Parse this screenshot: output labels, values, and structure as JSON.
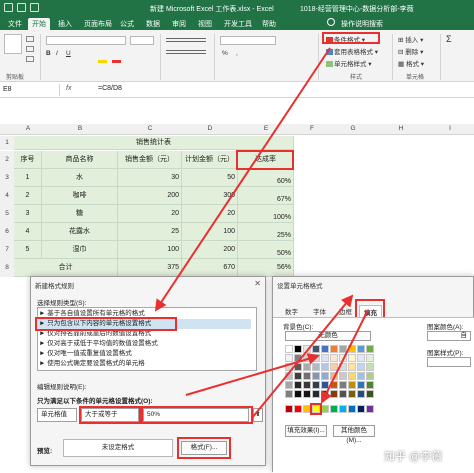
{
  "titlebar": {
    "title": "新建 Microsoft Excel 工作表.xlsx - Excel",
    "right_title": "1018-经营管理中心-数据分析部-李薇"
  },
  "tabs": [
    "文件",
    "开始",
    "插入",
    "页面布局",
    "公式",
    "数据",
    "审阅",
    "视图",
    "开发工具",
    "帮助",
    "操作说明搜索"
  ],
  "ribbon": {
    "groups": [
      "剪贴板",
      "样式",
      "单元格"
    ],
    "cond_format": "条件格式",
    "format_as_table": "套用表格格式",
    "cell_style": "单元格样式",
    "insert": "插入",
    "delete": "删除",
    "format": "格式"
  },
  "formula_bar": {
    "name_box": "E8",
    "fx": "fx",
    "formula": "=C8/D8"
  },
  "sheet": {
    "columns": [
      "A",
      "B",
      "C",
      "D",
      "E",
      "F",
      "G",
      "H",
      "I"
    ],
    "title": "销售统计表",
    "headers": [
      "序号",
      "商品名称",
      "销售金额（元）",
      "计划金额（元）",
      "达成率"
    ],
    "rows": [
      {
        "no": "1",
        "name": "水",
        "sales": "30",
        "plan": "50",
        "rate": "60%"
      },
      {
        "no": "2",
        "name": "咖啡",
        "sales": "200",
        "plan": "300",
        "rate": "67%"
      },
      {
        "no": "3",
        "name": "糖",
        "sales": "20",
        "plan": "20",
        "rate": "100%"
      },
      {
        "no": "4",
        "name": "花露水",
        "sales": "25",
        "plan": "100",
        "rate": "25%"
      },
      {
        "no": "5",
        "name": "湿巾",
        "sales": "100",
        "plan": "200",
        "rate": "50%"
      }
    ],
    "total": {
      "label": "合计",
      "sales": "375",
      "plan": "670",
      "rate": "56%"
    },
    "row_numbers": [
      "1",
      "2",
      "3",
      "4",
      "5",
      "6",
      "7",
      "8",
      "9",
      "10"
    ]
  },
  "rule_dialog": {
    "title": "新建格式规则",
    "select_type_label": "选择规则类型(S):",
    "rule_types": [
      "► 基于各自值设置所有单元格的格式",
      "► 只为包含以下内容的单元格设置格式",
      "► 仅对排名靠前或靠后的数值设置格式",
      "► 仅对高于或低于平均值的数值设置格式",
      "► 仅对唯一值或重复值设置格式",
      "► 使用公式确定要设置格式的单元格"
    ],
    "edit_label": "编辑规则说明(E):",
    "format_only_label": "只为满足以下条件的单元格设置格式(O):",
    "cond_field": "单元格值",
    "cond_op": "大于或等于",
    "cond_value": "50%",
    "preview_label": "预览:",
    "preview_text": "未设定格式",
    "format_button": "格式(F)..."
  },
  "cells_dialog": {
    "title": "设置单元格格式",
    "tabs": [
      "数字",
      "字体",
      "边框",
      "填充"
    ],
    "bg_label": "背景色(C):",
    "no_color": "无颜色",
    "fill_effects": "填充效果(I)...",
    "more_colors": "其他颜色(M)...",
    "pattern_color": "图案颜色(A):",
    "pattern_style": "图案样式(P):",
    "pattern_value": "自"
  },
  "watermark": "知乎 @李薇",
  "colors": {
    "excel_green": "#217346",
    "highlight_red": "#e8302e",
    "sheet_green": "#e2efda"
  }
}
